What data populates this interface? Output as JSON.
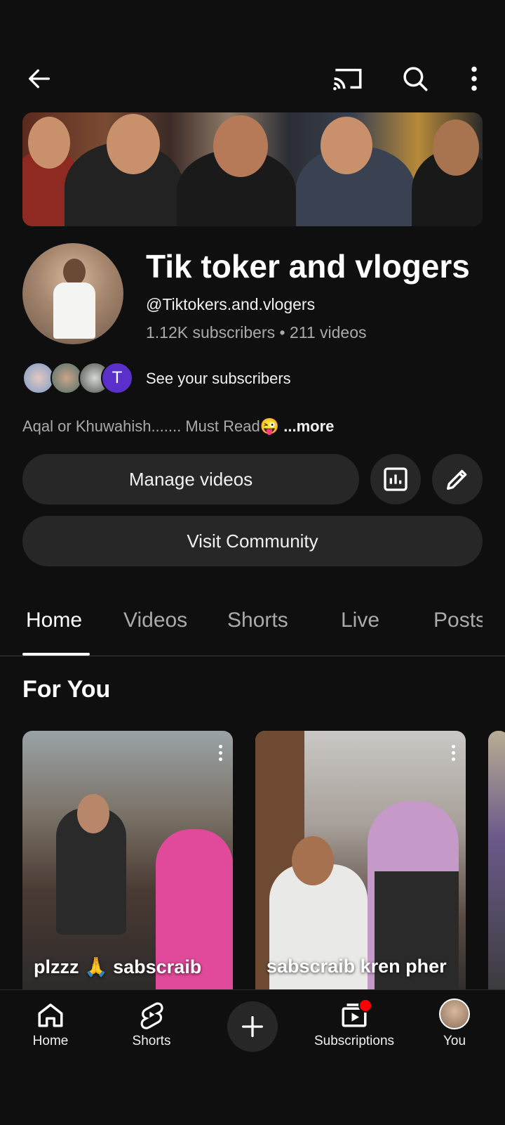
{
  "channel": {
    "name": "Tik toker and vlogers",
    "handle": "@Tiktokers.and.vlogers",
    "subscribers": "1.12K subscribers",
    "separator": "•",
    "videos": "211 videos",
    "see_subscribers": "See your subscribers",
    "subscriber_initial": "T",
    "description": "Aqal or Khuwahish....... Must Read😜",
    "more": "...more"
  },
  "actions": {
    "manage_videos": "Manage videos",
    "visit_community": "Visit Community"
  },
  "tabs": [
    {
      "label": "Home",
      "active": true
    },
    {
      "label": "Videos"
    },
    {
      "label": "Shorts"
    },
    {
      "label": "Live"
    },
    {
      "label": "Posts"
    }
  ],
  "section_title": "For You",
  "cards": [
    {
      "title": "plzzz 🙏 sabscraib"
    },
    {
      "title": "sabscraib kren pher"
    }
  ],
  "bottom_nav": {
    "home": "Home",
    "shorts": "Shorts",
    "subscriptions": "Subscriptions",
    "you": "You"
  },
  "colors": {
    "background": "#0f0f0f",
    "button": "#272727",
    "notification_dot": "#ff0000",
    "initial_avatar": "#5b2fc9"
  }
}
